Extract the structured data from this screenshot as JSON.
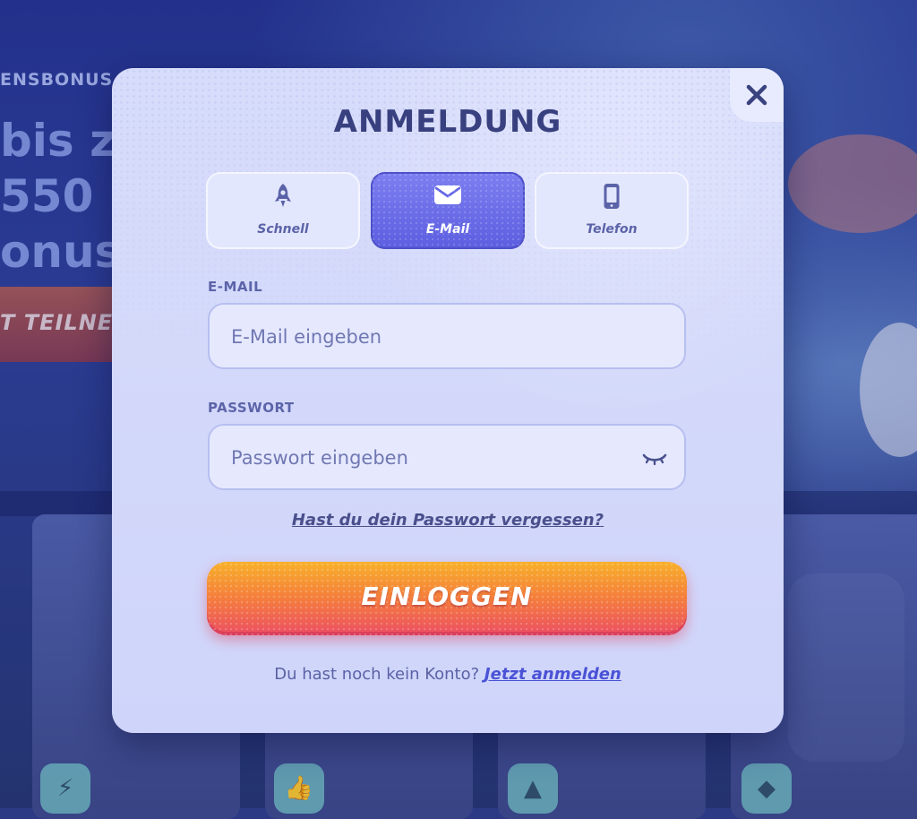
{
  "background": {
    "promo_label": "ENSBONUS",
    "promo_lines": [
      "bis z",
      "550 +",
      "onus 6"
    ],
    "cta_label": "T TEILNE",
    "tile_icons": [
      "bolt-icon",
      "thumbs-up-icon",
      "hat-icon",
      "diamond-icon"
    ]
  },
  "modal": {
    "title": "ANMELDUNG",
    "close_icon": "close-icon",
    "tabs": [
      {
        "label": "Schnell",
        "icon": "rocket-icon",
        "active": false
      },
      {
        "label": "E-Mail",
        "icon": "envelope-icon",
        "active": true
      },
      {
        "label": "Telefon",
        "icon": "phone-icon",
        "active": false
      }
    ],
    "email": {
      "label": "E-MAIL",
      "value": "",
      "placeholder": "E-Mail eingeben"
    },
    "password": {
      "label": "PASSWORT",
      "value": "",
      "placeholder": "Passwort eingeben",
      "toggle_icon": "eye-closed-icon"
    },
    "forgot_password": "Hast du dein Passwort vergessen?",
    "login_button": "EINLOGGEN",
    "signup_prompt": "Du hast noch kein Konto?",
    "signup_link": "Jetzt anmelden"
  },
  "colors": {
    "accent": "#5c5ee0",
    "title": "#38407f",
    "login_gradient_top": "#f8b12b",
    "login_gradient_bottom": "#ec4f63",
    "link": "#4a52d6"
  }
}
